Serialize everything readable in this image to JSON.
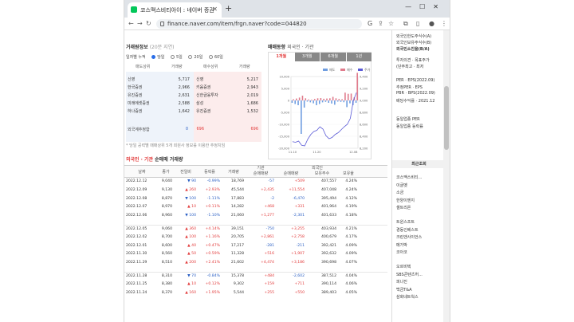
{
  "browser": {
    "tab_title": "코스맥스비티아이 : 네이버 증권",
    "url": "finance.naver.com/item/frgn.naver?code=044820"
  },
  "trade_section": {
    "title": "거래원정보",
    "subtitle": "(20분 지연)",
    "period_label": "일자별 누적",
    "periods": [
      "당일",
      "5일",
      "20일",
      "60일"
    ],
    "headers": [
      "매도상위",
      "거래량",
      "매수상위",
      "거래량"
    ],
    "rows": [
      {
        "seller": "신영",
        "sell_vol": "5,717",
        "buyer": "신영",
        "buy_vol": "5,217"
      },
      {
        "seller": "한국증권",
        "sell_vol": "2,966",
        "buyer": "키움증권",
        "buy_vol": "2,943"
      },
      {
        "seller": "유진증권",
        "sell_vol": "2,631",
        "buyer": "신한금융투자",
        "buy_vol": "2,019"
      },
      {
        "seller": "미래에셋증권",
        "sell_vol": "2,588",
        "buyer": "삼성",
        "buy_vol": "1,686"
      },
      {
        "seller": "하나증권",
        "sell_vol": "1,642",
        "buyer": "유진증권",
        "buy_vol": "1,532"
      }
    ],
    "foreign_label": "외국계추정합",
    "foreign_sell": "0",
    "foreign_sell2": "696",
    "foreign_buy": "696",
    "note": "* 당일 공력별 매매상위 5개 회원사 정보를 이용한 추정치임"
  },
  "chart_section": {
    "title": "매매동향",
    "subtitle": "외국인 · 기관",
    "tabs": [
      "1개월",
      "3개월",
      "6개월",
      "1년"
    ],
    "legend": [
      "매도",
      "매수",
      "주가"
    ],
    "y_left_ticks": [
      "10,000",
      "5,000",
      "0",
      "-5,000",
      "-10,000",
      "-15,000",
      "-20,000"
    ],
    "y_right_ticks": [
      "9,400",
      "9,200",
      "9,000",
      "8,800",
      "8,600",
      "8,400",
      "8,200"
    ],
    "x_ticks": [
      "11.10",
      "11.20",
      "12.08"
    ]
  },
  "chart_data": {
    "type": "bar",
    "title": "매매동향",
    "categories": [
      "11.10",
      "11.11",
      "11.14",
      "11.15",
      "11.16",
      "11.17",
      "11.18",
      "11.21",
      "11.22",
      "11.23",
      "11.24",
      "11.25",
      "11.28",
      "11.29",
      "11.30",
      "12.01",
      "12.02",
      "12.05",
      "12.06",
      "12.07",
      "12.08",
      "12.09"
    ],
    "series": [
      {
        "name": "매도",
        "values": [
          -1000,
          -1500,
          -2000,
          -14000,
          -3000,
          -500,
          -800,
          -1200,
          -2000,
          -1500,
          -800,
          -600,
          -1000,
          -1300,
          -1800,
          -500,
          -600,
          -750,
          -2800,
          -1200,
          -2000,
          -1000
        ]
      },
      {
        "name": "매수",
        "values": [
          500,
          800,
          1200,
          2000,
          900,
          400,
          300,
          600,
          900,
          1000,
          700,
          800,
          900,
          1500,
          900,
          600,
          500,
          3255,
          2758,
          2861,
          1277,
          11554
        ]
      },
      {
        "name": "주가",
        "values": [
          8310,
          8300,
          8320,
          8250,
          8240,
          8350,
          8430,
          8480,
          8500,
          8560,
          8520,
          8410,
          8360,
          8380,
          8430,
          8460,
          8510,
          8560,
          8600,
          8700,
          9000,
          9130
        ]
      }
    ],
    "ylim": [
      -20000,
      10000
    ]
  },
  "sidebar": {
    "items": [
      "외국인한도주식수(A)",
      "외국인보유주식수(B)",
      "외국인소진율(B/A)",
      "투자의견 · 목표주가",
      "(단주최고 · 최저",
      "PER · EPS(2022.09)",
      "추정PER · EPS",
      "PBR · BPS(2022.09)",
      "배당수익률 · 2021.12",
      "동일업종 PER",
      "동일업종 등락률"
    ],
    "recent_title": "최근조회",
    "recent_groups": [
      [
        "코스맥스비티...",
        "이글벳",
        "소금",
        "한양이엔지",
        "셀트리온"
      ],
      [
        "트윈스조트",
        "경동인베스트",
        "크린앤사이언스",
        "메가박",
        "코아코"
      ],
      [
        "오르비텍",
        "SBS콘텐츠허...",
        "피나진",
        "백금T&A",
        "삼화네트웍스"
      ]
    ]
  },
  "flow_section": {
    "title_red": "외국인 · 기관",
    "title_rest": "순매매 거래량",
    "headers": {
      "date": "날짜",
      "close": "종가",
      "change": "전일비",
      "rate": "등락률",
      "volume": "거래량",
      "inst": "기관",
      "inst_net": "순매매량",
      "frgn": "외국인",
      "frgn_net": "순매매량",
      "frgn_hold": "보유주수",
      "frgn_rate": "보유율"
    },
    "groups": [
      [
        {
          "date": "2022.12.12",
          "close": "9,040",
          "dir": "down",
          "change": "90",
          "rate": "-0.99%",
          "vol": "18,769",
          "inst": "-57",
          "frgn": "+509",
          "hold": "407,557",
          "hrate": "4.24%"
        },
        {
          "date": "2022.12.09",
          "close": "9,130",
          "dir": "up",
          "change": "260",
          "rate": "+2.93%",
          "vol": "45,544",
          "inst": "+2,435",
          "frgn": "+11,554",
          "hold": "407,048",
          "hrate": "4.24%"
        },
        {
          "date": "2022.12.08",
          "close": "8,870",
          "dir": "down",
          "change": "100",
          "rate": "-1.11%",
          "vol": "17,883",
          "inst": "-2",
          "frgn": "-6,470",
          "hold": "395,494",
          "hrate": "4.12%"
        },
        {
          "date": "2022.12.07",
          "close": "8,970",
          "dir": "up",
          "change": "10",
          "rate": "+0.11%",
          "vol": "14,282",
          "inst": "+468",
          "frgn": "+331",
          "hold": "401,964",
          "hrate": "4.19%"
        },
        {
          "date": "2022.12.06",
          "close": "8,960",
          "dir": "down",
          "change": "100",
          "rate": "-1.10%",
          "vol": "21,060",
          "inst": "+1,277",
          "frgn": "-2,301",
          "hold": "401,633",
          "hrate": "4.18%"
        }
      ],
      [
        {
          "date": "2022.12.05",
          "close": "9,060",
          "dir": "up",
          "change": "360",
          "rate": "+4.14%",
          "vol": "39,151",
          "inst": "-750",
          "frgn": "+3,255",
          "hold": "403,934",
          "hrate": "4.21%"
        },
        {
          "date": "2022.12.02",
          "close": "8,700",
          "dir": "up",
          "change": "100",
          "rate": "+1.16%",
          "vol": "20,705",
          "inst": "+2,861",
          "frgn": "+2,758",
          "hold": "400,679",
          "hrate": "4.17%"
        },
        {
          "date": "2022.12.01",
          "close": "8,600",
          "dir": "up",
          "change": "40",
          "rate": "+0.47%",
          "vol": "17,217",
          "inst": "-281",
          "frgn": "-211",
          "hold": "392,421",
          "hrate": "4.09%"
        },
        {
          "date": "2022.11.30",
          "close": "8,560",
          "dir": "up",
          "change": "50",
          "rate": "+0.59%",
          "vol": "11,328",
          "inst": "+516",
          "frgn": "+1,907",
          "hold": "392,632",
          "hrate": "4.09%"
        },
        {
          "date": "2022.11.29",
          "close": "8,510",
          "dir": "up",
          "change": "200",
          "rate": "+2.41%",
          "vol": "21,602",
          "inst": "+4,474",
          "frgn": "+3,186",
          "hold": "390,698",
          "hrate": "4.07%"
        }
      ],
      [
        {
          "date": "2022.11.28",
          "close": "8,310",
          "dir": "down",
          "change": "70",
          "rate": "-0.84%",
          "vol": "15,378",
          "inst": "+484",
          "frgn": "-2,602",
          "hold": "387,512",
          "hrate": "4.04%"
        },
        {
          "date": "2022.11.25",
          "close": "8,380",
          "dir": "up",
          "change": "10",
          "rate": "+0.12%",
          "vol": "9,302",
          "inst": "+159",
          "frgn": "+711",
          "hold": "390,114",
          "hrate": "4.06%"
        },
        {
          "date": "2022.11.24",
          "close": "8,370",
          "dir": "up",
          "change": "160",
          "rate": "+1.95%",
          "vol": "5,544",
          "inst": "+255",
          "frgn": "+550",
          "hold": "389,403",
          "hrate": "4.05%"
        }
      ]
    ]
  }
}
